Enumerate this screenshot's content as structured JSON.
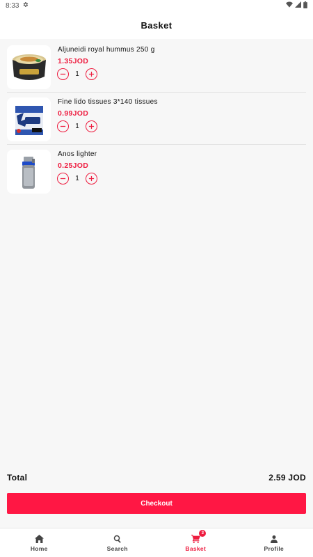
{
  "status_bar": {
    "time": "8:33"
  },
  "app_bar": {
    "title": "Basket"
  },
  "items": [
    {
      "name": "Aljuneidi royal hummus 250 g",
      "price": "1.35JOD",
      "quantity": "1",
      "image_icon": "hummus-jar-image"
    },
    {
      "name": "Fine lido tissues 3*140 tissues",
      "price": "0.99JOD",
      "quantity": "1",
      "image_icon": "tissue-box-image"
    },
    {
      "name": "Anos lighter",
      "price": "0.25JOD",
      "quantity": "1",
      "image_icon": "lighter-image"
    }
  ],
  "summary": {
    "total_label": "Total",
    "total_value": "2.59 JOD"
  },
  "checkout": {
    "label": "Checkout"
  },
  "nav": {
    "items": [
      {
        "label": "Home",
        "icon": "home-icon"
      },
      {
        "label": "Search",
        "icon": "search-icon"
      },
      {
        "label": "Basket",
        "icon": "cart-icon",
        "badge": "3"
      },
      {
        "label": "Profile",
        "icon": "person-icon"
      }
    ],
    "active_index": 2
  },
  "colors": {
    "accent": "#ee1c3f",
    "button": "#ff1744",
    "background": "#f7f7f7"
  }
}
